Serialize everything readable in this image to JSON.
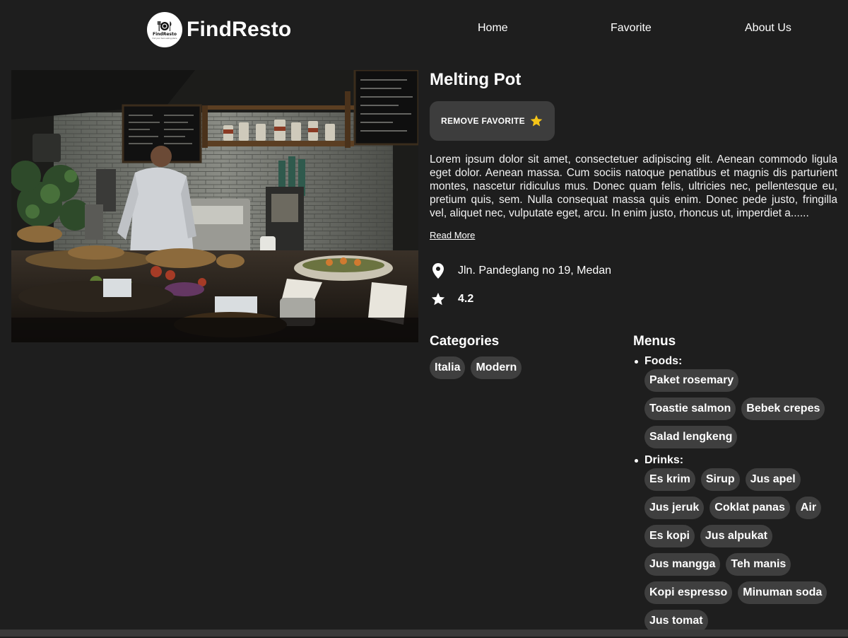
{
  "header": {
    "logo_text": "FindResto",
    "logo_sub": "find your best eating place",
    "brand_name": "FindResto",
    "nav": [
      "Home",
      "Favorite",
      "About Us"
    ]
  },
  "restaurant": {
    "name": "Melting Pot",
    "favorite_button_label": "REMOVE FAVORITE",
    "description": "Lorem ipsum dolor sit amet, consectetuer adipiscing elit. Aenean commodo ligula eget dolor. Aenean massa. Cum sociis natoque penatibus et magnis dis parturient montes, nascetur ridiculus mus. Donec quam felis, ultricies nec, pellentesque eu, pretium quis, sem. Nulla consequat massa quis enim. Donec pede justo, fringilla vel, aliquet nec, vulputate eget, arcu. In enim justo, rhoncus ut, imperdiet a......",
    "read_more_label": "Read More",
    "address": "Jln. Pandeglang no 19, Medan",
    "rating": "4.2"
  },
  "categories": {
    "title": "Categories",
    "items": [
      "Italia",
      "Modern"
    ]
  },
  "menus": {
    "title": "Menus",
    "groups": [
      {
        "label": "Foods:",
        "items": [
          "Paket rosemary",
          "Toastie salmon",
          "Bebek crepes",
          "Salad lengkeng"
        ]
      },
      {
        "label": "Drinks:",
        "items": [
          "Es krim",
          "Sirup",
          "Jus apel",
          "Jus jeruk",
          "Coklat panas",
          "Air",
          "Es kopi",
          "Jus alpukat",
          "Jus mangga",
          "Teh manis",
          "Kopi espresso",
          "Minuman soda",
          "Jus tomat"
        ]
      }
    ]
  },
  "icons": {
    "favorite": "star-icon",
    "address": "location-pin-icon",
    "rating": "star-icon",
    "logo": "plate-cutlery-icon"
  },
  "colors": {
    "background": "#1e1e1e",
    "chip": "#3f3f3f",
    "button": "#3d3d3d",
    "favorite_star": "#f5c518",
    "text": "#ffffff"
  }
}
